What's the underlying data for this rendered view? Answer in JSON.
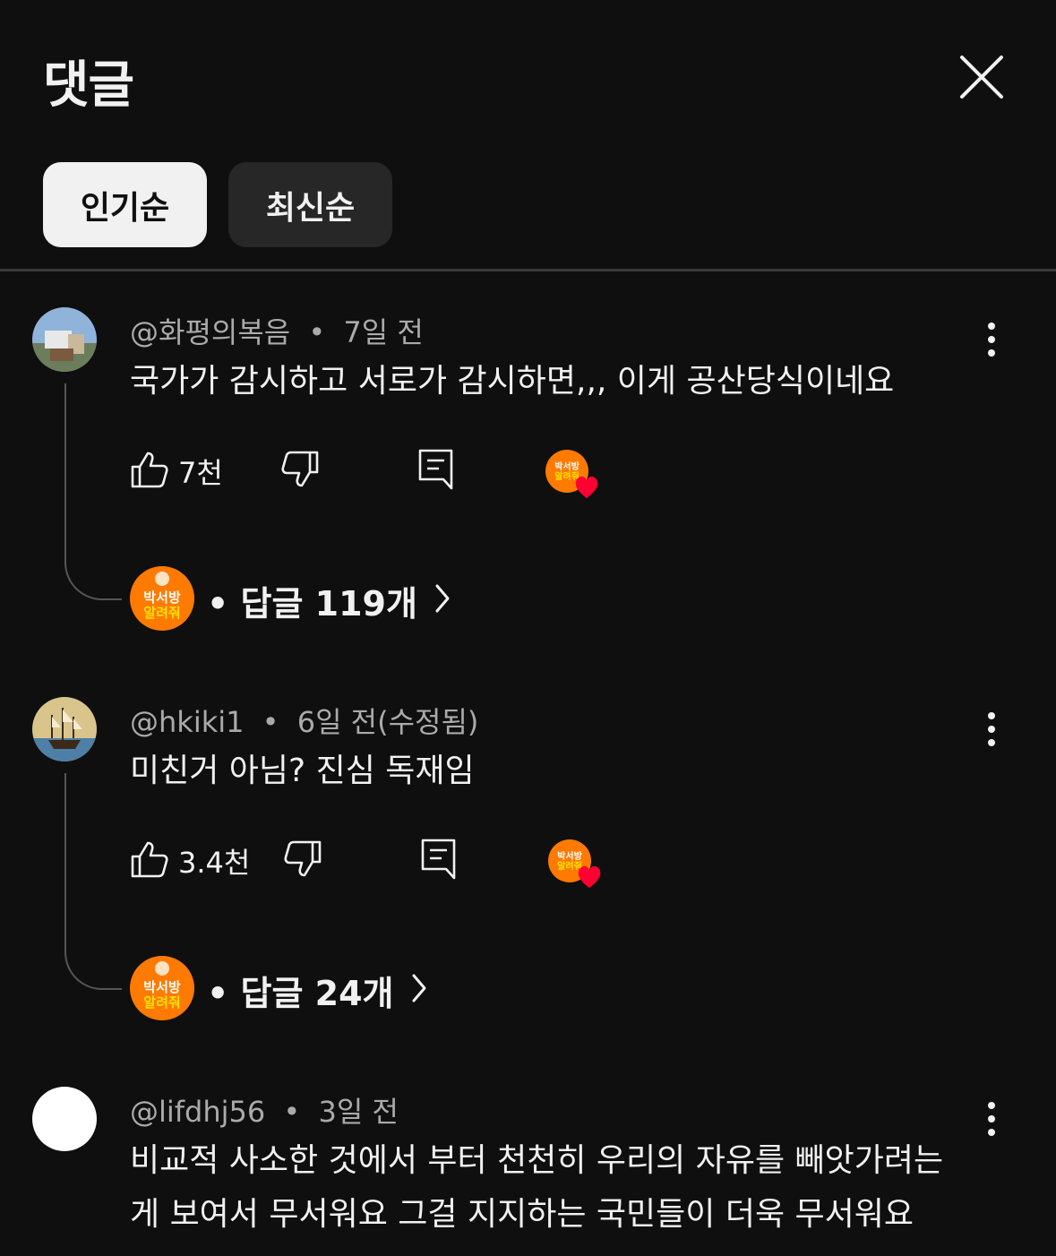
{
  "header": {
    "title": "댓글"
  },
  "sort_chips": [
    {
      "label": "인기순",
      "active": true
    },
    {
      "label": "최신순",
      "active": false
    }
  ],
  "comments": [
    {
      "author": "@화평의복음",
      "time": "7일 전",
      "text": "국가가 감시하고 서로가 감시하면,,, 이게 공산당식이네요",
      "likes": "7천",
      "creator_heart": true,
      "replies_label": "• 답글 119개"
    },
    {
      "author": "@hkiki1",
      "time": "6일 전(수정됨)",
      "text": "미친거 아님? 진심 독재임",
      "likes": "3.4천",
      "creator_heart": true,
      "replies_label": "• 답글 24개"
    },
    {
      "author": "@lifdhj56",
      "time": "3일 전",
      "text": "비교적 사소한 것에서 부터 천천히 우리의 자유를 빼앗가려는게 보여서 무서워요 그걸 지지하는 국민들이 더욱 무서워요"
    }
  ],
  "creator_badge": {
    "line1": "박서방",
    "line2": "알려줘"
  },
  "meta_separator": "•",
  "colors": {
    "background": "#0f0f0f",
    "chip_active": "#f1f1f1",
    "chip_inactive": "#272727",
    "heart": "#ff0033",
    "creator_avatar": "#ff7a00"
  },
  "icons": [
    "close-icon",
    "more-vert-icon",
    "thumb-up-icon",
    "thumb-down-icon",
    "reply-icon",
    "heart-icon",
    "chevron-right-icon"
  ]
}
